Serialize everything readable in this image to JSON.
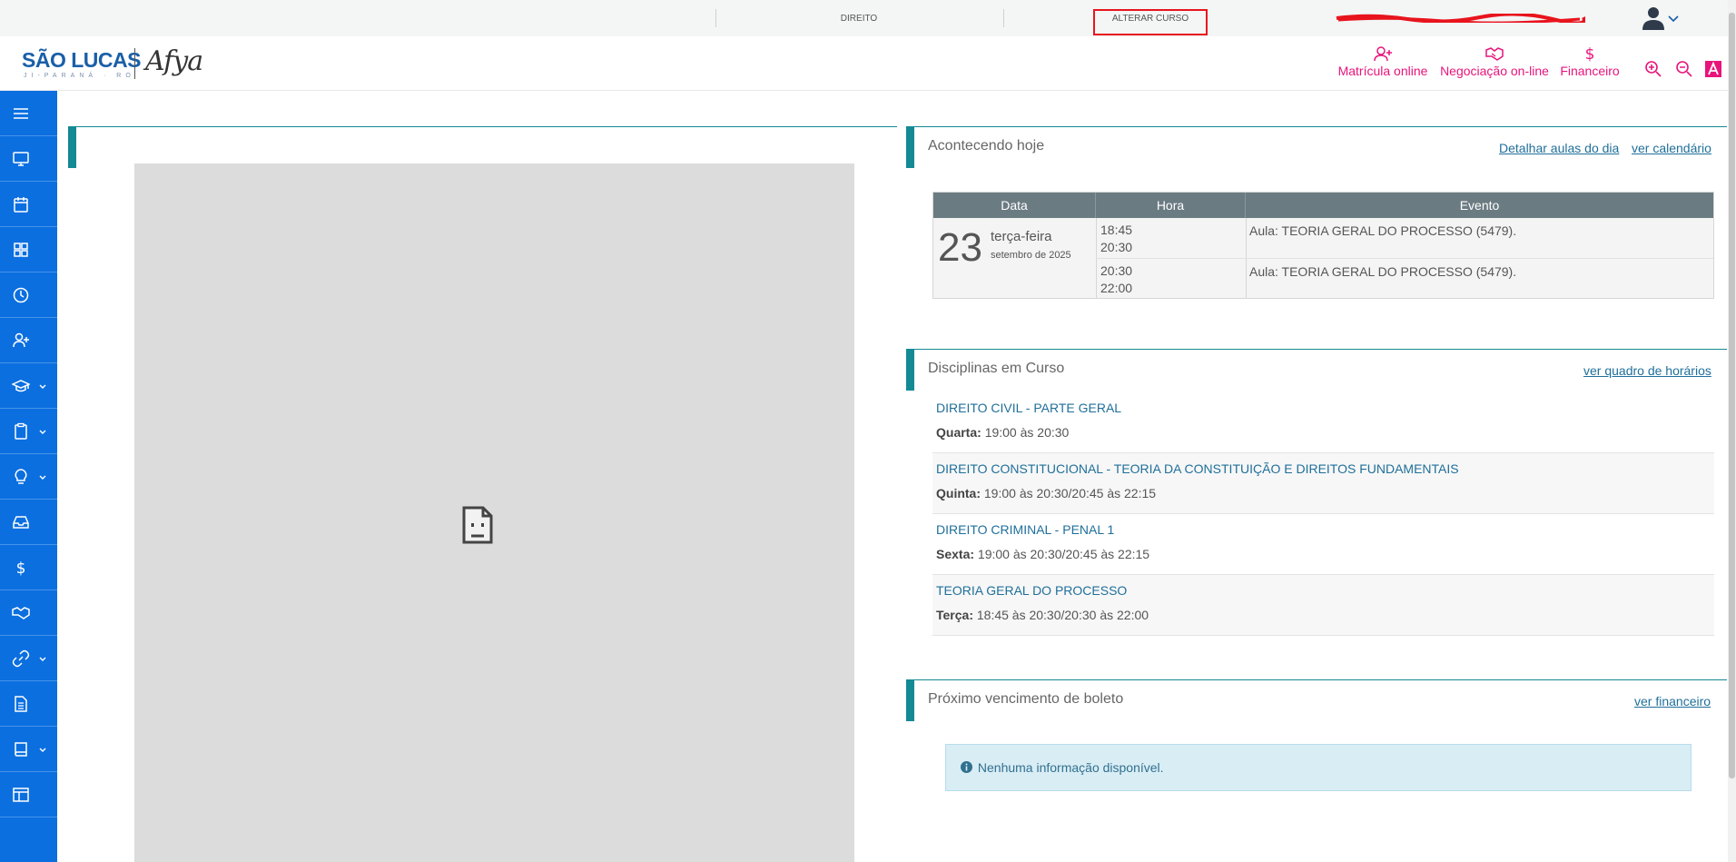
{
  "topbar": {
    "course": "DIREITO",
    "change_course": "ALTERAR CURSO"
  },
  "header": {
    "logo_main": "SÃO LUCAS",
    "logo_sub": "JI-PARANÁ · RO",
    "logo_brand": "Afya",
    "nav": [
      {
        "label": "Matrícula online",
        "icon": "user-plus-icon"
      },
      {
        "label": "Negociação on-line",
        "icon": "handshake-icon"
      },
      {
        "label": "Financeiro",
        "icon": "dollar-icon"
      }
    ]
  },
  "colors": {
    "accent": "#e8147b",
    "sidebar": "#0b6fe0",
    "teal": "#138a94",
    "link": "#1f6f9a"
  },
  "sidebar": {
    "items": [
      {
        "icon": "menu-icon"
      },
      {
        "icon": "monitor-icon"
      },
      {
        "icon": "calendar-icon"
      },
      {
        "icon": "grid-icon"
      },
      {
        "icon": "clock-icon"
      },
      {
        "icon": "user-plus-icon"
      },
      {
        "icon": "graduation-cap-icon",
        "submenu": true
      },
      {
        "icon": "clipboard-icon",
        "submenu": true
      },
      {
        "icon": "lightbulb-icon",
        "submenu": true
      },
      {
        "icon": "inbox-icon"
      },
      {
        "icon": "dollar-icon"
      },
      {
        "icon": "handshake-icon"
      },
      {
        "icon": "link-icon",
        "submenu": true
      },
      {
        "icon": "document-icon"
      },
      {
        "icon": "book-icon",
        "submenu": true
      },
      {
        "icon": "layout-icon"
      }
    ]
  },
  "today": {
    "title": "Acontecendo hoje",
    "link_detail": "Detalhar aulas do dia",
    "link_calendar": "ver calendário",
    "columns": [
      "Data",
      "Hora",
      "Evento"
    ],
    "day": "23",
    "weekday": "terça-feira",
    "month": "setembro de 2025",
    "events": [
      {
        "start": "18:45",
        "end": "20:30",
        "event": "Aula: TEORIA GERAL DO PROCESSO (5479)."
      },
      {
        "start": "20:30",
        "end": "22:00",
        "event": "Aula: TEORIA GERAL DO PROCESSO (5479)."
      }
    ]
  },
  "disciplines": {
    "title": "Disciplinas em Curso",
    "link": "ver quadro de horários",
    "items": [
      {
        "name": "DIREITO CIVIL - PARTE GERAL",
        "day": "Quarta:",
        "time": "19:00 às 20:30"
      },
      {
        "name": "DIREITO CONSTITUCIONAL - TEORIA DA CONSTITUIÇÃO E DIREITOS FUNDAMENTAIS",
        "day": "Quinta:",
        "time": "19:00 às 20:30/20:45 às 22:15"
      },
      {
        "name": "DIREITO CRIMINAL - PENAL 1",
        "day": "Sexta:",
        "time": "19:00 às 20:30/20:45 às 22:15"
      },
      {
        "name": "TEORIA GERAL DO PROCESSO",
        "day": "Terça:",
        "time": "18:45 às 20:30/20:30 às 22:00"
      }
    ]
  },
  "boleto": {
    "title": "Próximo vencimento de boleto",
    "link": "ver financeiro",
    "info": "Nenhuma informação disponível."
  }
}
